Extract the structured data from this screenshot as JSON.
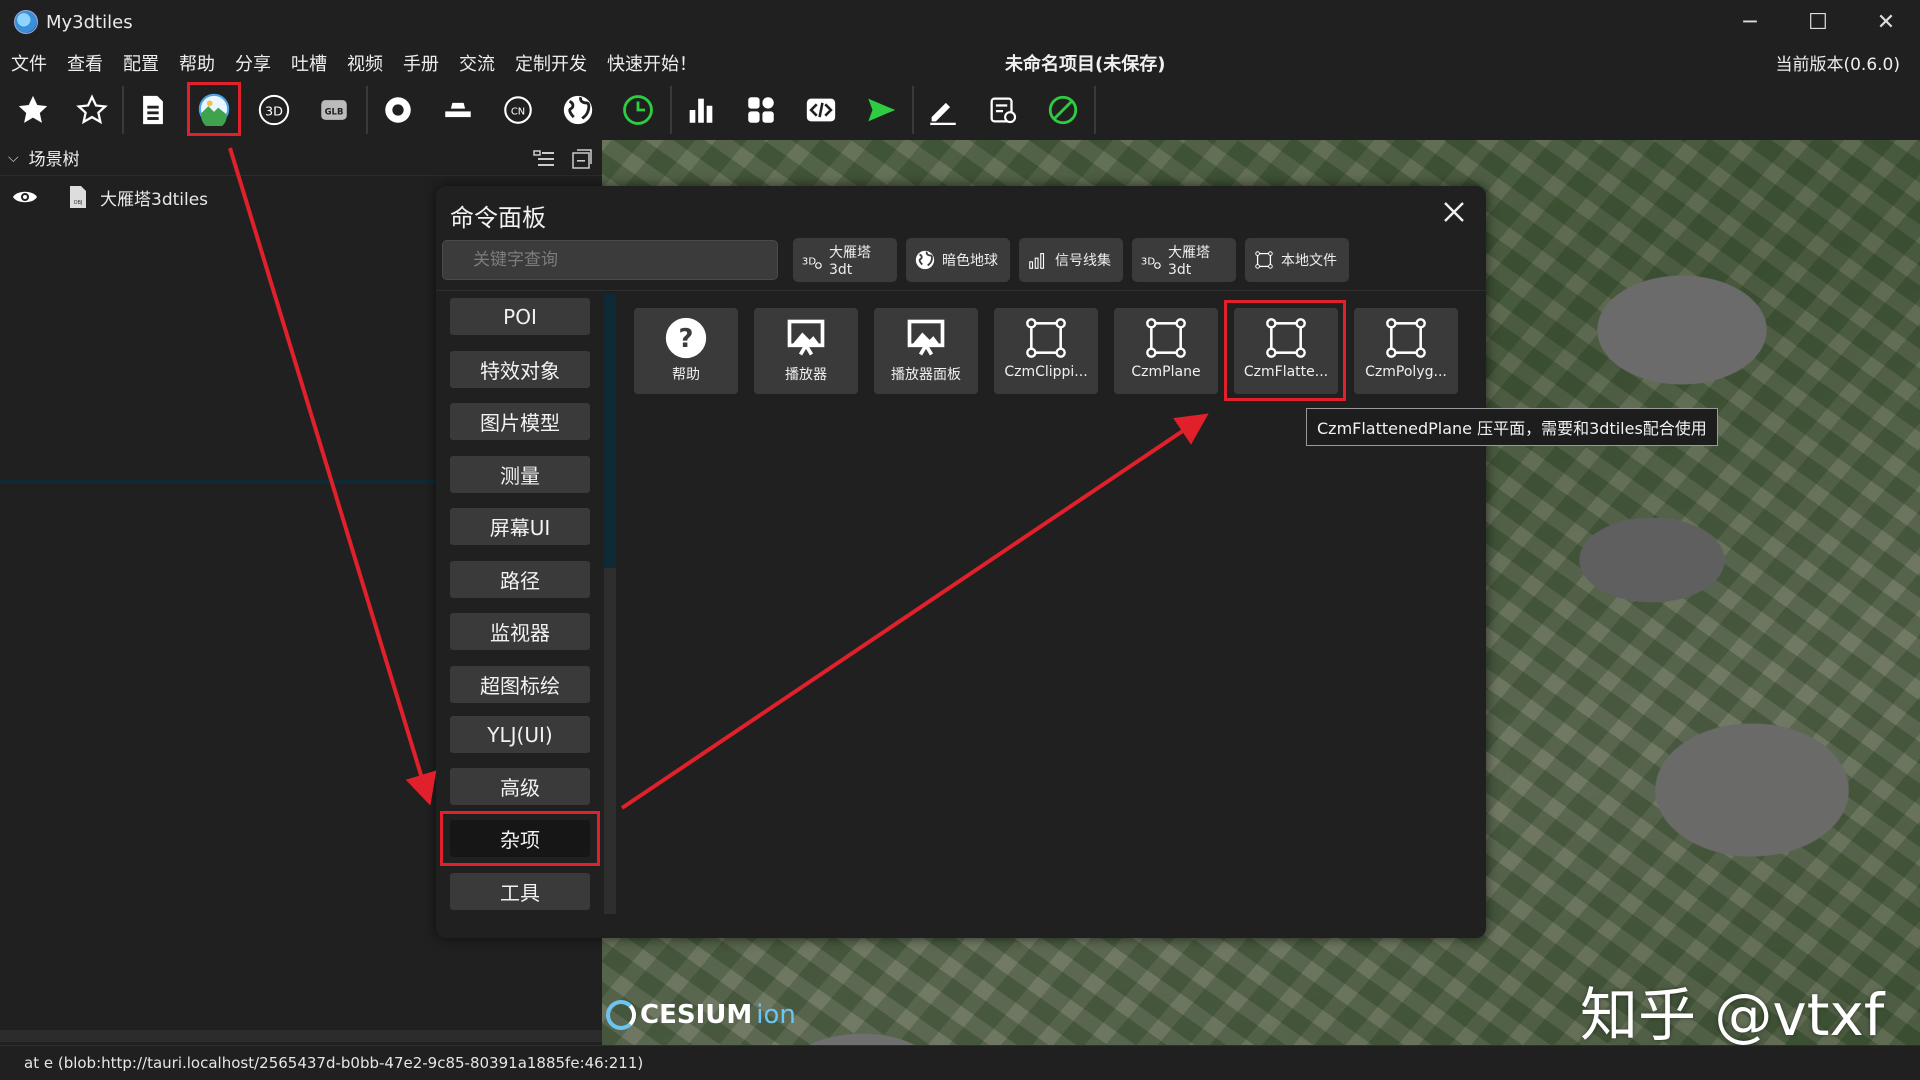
{
  "window": {
    "app_title": "My3dtiles",
    "controls": {
      "minimize": "─",
      "maximize": "☐",
      "close": "✕"
    }
  },
  "menu": {
    "items": [
      "文件",
      "查看",
      "配置",
      "帮助",
      "分享",
      "吐槽",
      "视频",
      "手册",
      "交流",
      "定制开发",
      "快速开始！"
    ],
    "project_title": "未命名项目(未保存)",
    "version": "当前版本(0.6.0)"
  },
  "toolbar": {
    "icons": [
      "star-filled-icon",
      "star-outline-icon",
      "document-icon",
      "image-model-icon",
      "3d-icon",
      "glb-icon",
      "poi-icon",
      "terrain-icon",
      "cn-icon",
      "globe-icon",
      "clock-icon",
      "bar-chart-icon",
      "grid-apps-icon",
      "code-icon",
      "play-icon",
      "edit-icon",
      "settings-list-icon",
      "disable-icon"
    ],
    "highlighted": "image-model-icon",
    "play_color": "#2ecc40",
    "clock_color": "#2ecc40",
    "disable_color": "#2ecc40"
  },
  "scene_tree": {
    "title": "场景树",
    "items": [
      {
        "label": "大雁塔3dtiles",
        "icon": "obj-file-icon",
        "visible": true
      }
    ]
  },
  "command_panel": {
    "title": "命令面板",
    "search_placeholder": "关键字查询",
    "recent": [
      {
        "label": "大雁塔3dt",
        "icon": "3d-tiles-icon"
      },
      {
        "label": "暗色地球",
        "icon": "globe-icon"
      },
      {
        "label": "信号线集",
        "icon": "signal-bars-icon"
      },
      {
        "label": "大雁塔3dt",
        "icon": "3d-tiles-icon"
      },
      {
        "label": "本地文件",
        "icon": "selection-frame-icon"
      }
    ],
    "categories": [
      "POI",
      "特效对象",
      "图片模型",
      "测量",
      "屏幕UI",
      "路径",
      "监视器",
      "超图标绘",
      "YLJ(UI)",
      "高级",
      "杂项",
      "工具"
    ],
    "active_category": "杂项",
    "commands": [
      {
        "label": "帮助",
        "icon": "help-icon"
      },
      {
        "label": "播放器",
        "icon": "player-icon"
      },
      {
        "label": "播放器面板",
        "icon": "player-panel-icon"
      },
      {
        "label": "CzmClippi...",
        "icon": "selection-frame-icon"
      },
      {
        "label": "CzmPlane",
        "icon": "selection-frame-icon"
      },
      {
        "label": "CzmFlatte...",
        "icon": "selection-frame-icon"
      },
      {
        "label": "CzmPolyg...",
        "icon": "selection-frame-icon"
      }
    ],
    "highlighted_command": "CzmFlatte...",
    "tooltip": "CzmFlattenedPlane 压平面，需要和3dtiles配合使用"
  },
  "viewport": {
    "logo_main": "CESIUM",
    "logo_sub": "ion",
    "watermark": "知乎 @vtxf"
  },
  "status": {
    "text": "at e (blob:http://tauri.localhost/2565437d-b0bb-47e2-9c85-80391a1885fe:46:211)"
  },
  "colors": {
    "annotation_red": "#e0202a",
    "accent_blue": "#6cc5f0"
  }
}
